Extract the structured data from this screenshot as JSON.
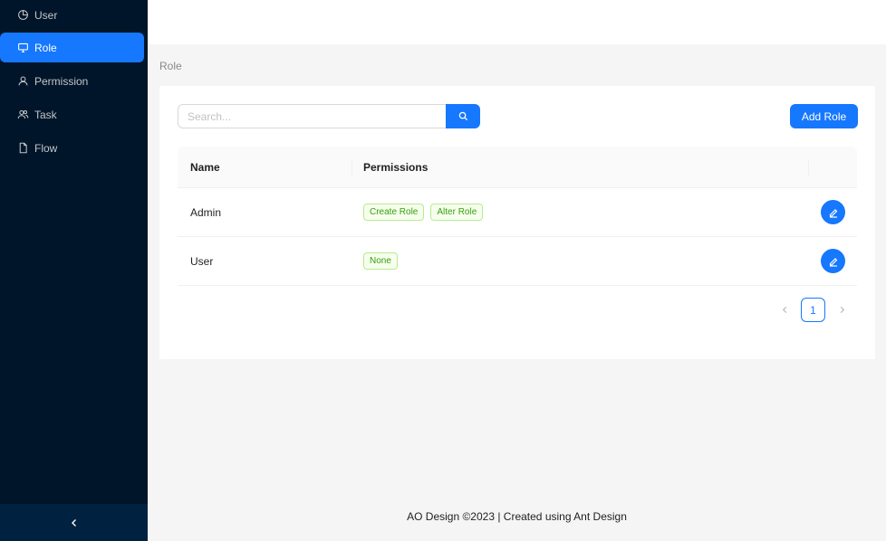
{
  "sidebar": {
    "items": [
      {
        "label": "User",
        "icon": "pie-chart-icon"
      },
      {
        "label": "Role",
        "icon": "desktop-icon",
        "active": true
      },
      {
        "label": "Permission",
        "icon": "user-icon"
      },
      {
        "label": "Task",
        "icon": "team-icon"
      },
      {
        "label": "Flow",
        "icon": "file-icon"
      }
    ],
    "collapse_icon": "left-chevron-icon",
    "bg_color": "#001529",
    "active_color": "#1677ff"
  },
  "breadcrumb": {
    "current": "Role"
  },
  "search": {
    "placeholder": "Search...",
    "value": ""
  },
  "toolbar": {
    "add_label": "Add Role"
  },
  "table": {
    "columns": [
      "Name",
      "Permissions"
    ],
    "rows": [
      {
        "name": "Admin",
        "permissions": [
          "Create Role",
          "Alter Role"
        ]
      },
      {
        "name": "User",
        "permissions": [
          "None"
        ]
      }
    ]
  },
  "pagination": {
    "current": "1"
  },
  "footer": {
    "text": "AO Design ©2023 | Created using Ant Design"
  }
}
